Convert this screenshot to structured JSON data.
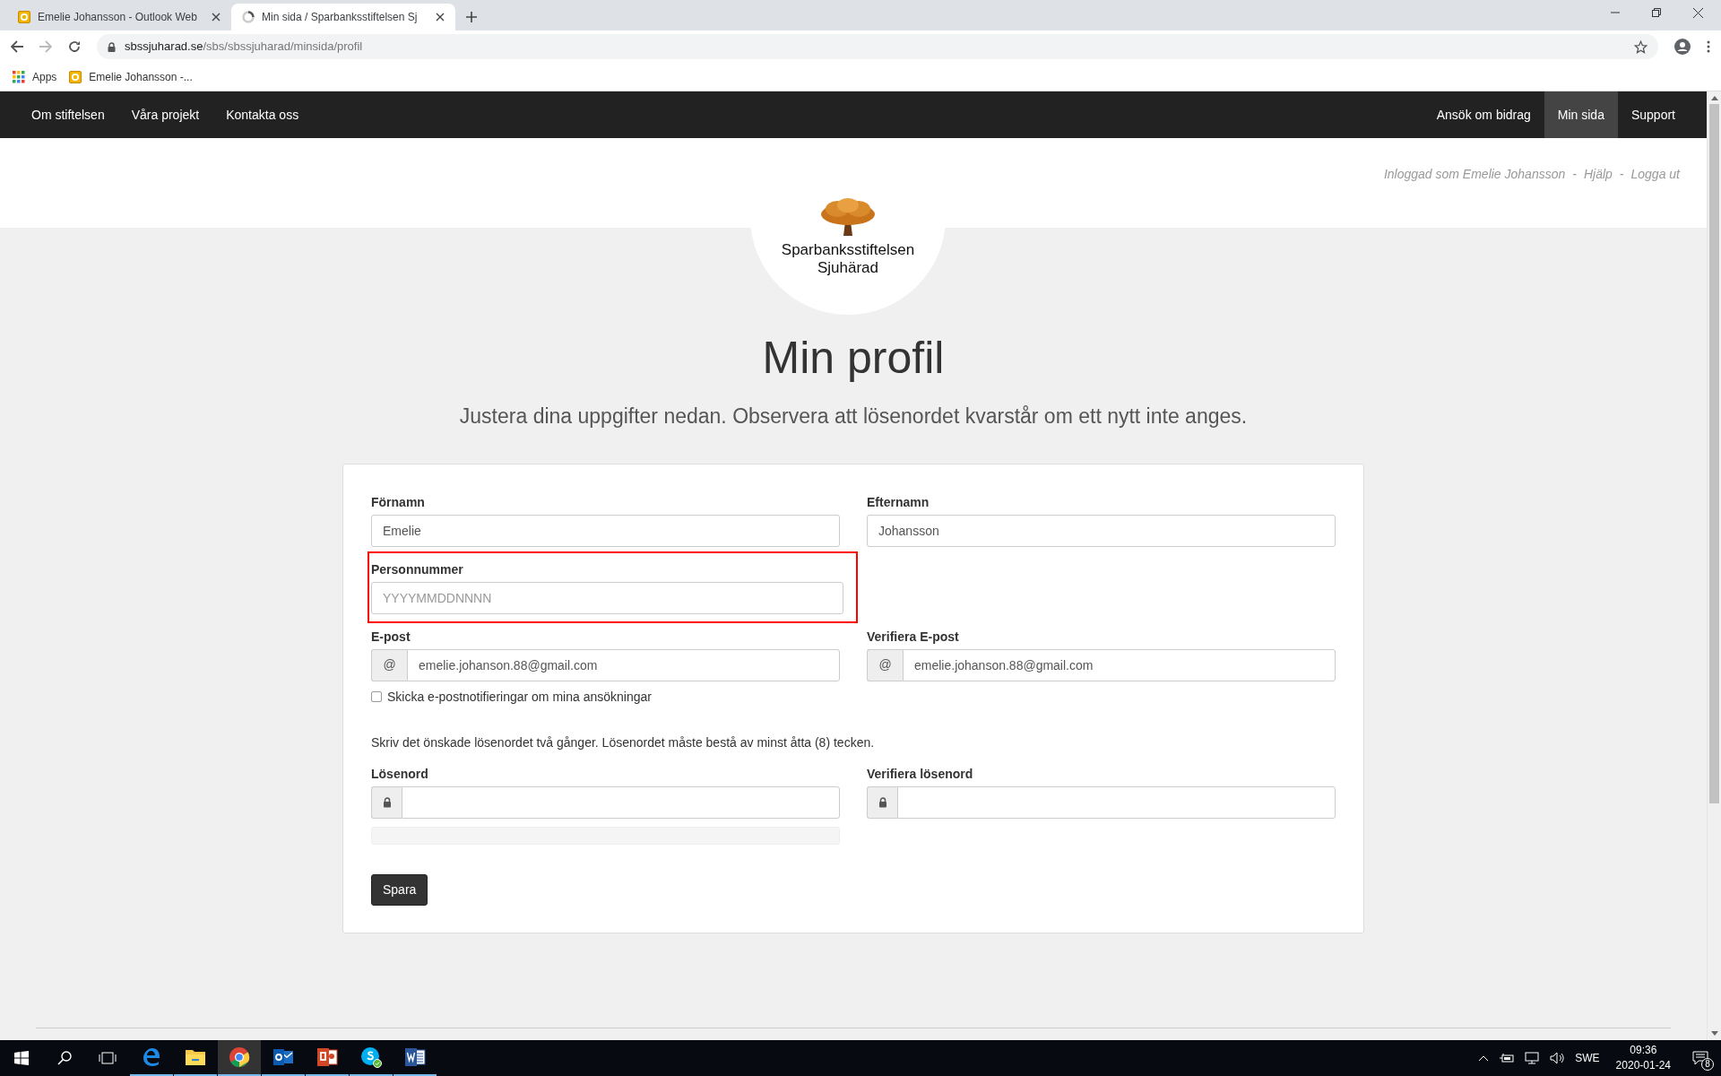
{
  "browser": {
    "tabs": [
      {
        "title": "Emelie Johansson - Outlook Web",
        "selected": false
      },
      {
        "title": "Min sida / Sparbanksstiftelsen Sj",
        "selected": true
      }
    ],
    "url": {
      "domain": "sbssjuharad.se",
      "path": "/sbs/sbssjuharad/minsida/profil"
    },
    "bookmarks": [
      {
        "label": "Apps"
      },
      {
        "label": "Emelie Johansson -..."
      }
    ]
  },
  "nav": {
    "left": [
      {
        "label": "Om stiftelsen",
        "selected": false
      },
      {
        "label": "Våra projekt",
        "selected": false
      },
      {
        "label": "Kontakta oss",
        "selected": false
      }
    ],
    "right": [
      {
        "label": "Ansök om bidrag",
        "selected": false
      },
      {
        "label": "Min sida",
        "selected": true
      },
      {
        "label": "Support",
        "selected": false
      }
    ]
  },
  "header": {
    "logo_lines": [
      "Sparbanksstiftelsen",
      "Sjuhärad"
    ],
    "user_links": [
      "Inloggad som Emelie Johansson",
      "-",
      "Hjälp",
      "-",
      "Logga ut"
    ]
  },
  "page": {
    "title": "Min profil",
    "subtitle": "Justera dina uppgifter nedan. Observera att lösenordet kvarstår om ett nytt inte anges."
  },
  "form": {
    "rows": [
      {
        "kind": "fields",
        "fields": [
          {
            "kind": "plain",
            "label": "Förnamn",
            "value": "Emelie",
            "highlighted": false
          },
          {
            "kind": "plain",
            "label": "Efternamn",
            "value": "Johansson",
            "highlighted": false
          }
        ]
      },
      {
        "kind": "fields",
        "fields": [
          {
            "kind": "plain",
            "label": "Personnummer",
            "placeholder": "YYYYMMDDNNNN",
            "highlighted": true
          }
        ]
      },
      {
        "kind": "fields",
        "fields": [
          {
            "kind": "email",
            "label": "E-post",
            "value": "emelie.johanson.88@gmail.com",
            "addon_text": "@",
            "highlighted": false
          },
          {
            "kind": "email",
            "label": "Verifiera E-post",
            "value": "emelie.johanson.88@gmail.com",
            "addon_text": "@",
            "highlighted": false
          }
        ]
      },
      {
        "kind": "checkbox",
        "label": "Skicka e-postnotifieringar om mina ansökningar",
        "checked": false
      },
      {
        "kind": "note",
        "text": "Skriv det önskade lösenordet två gånger. Lösenordet måste bestå av minst åtta (8) tecken."
      },
      {
        "kind": "fields",
        "fields": [
          {
            "kind": "password",
            "label": "Lösenord",
            "highlighted": false,
            "strength_meter": {
              "level": 0
            }
          },
          {
            "kind": "password",
            "label": "Verifiera lösenord",
            "highlighted": false
          }
        ]
      },
      {
        "kind": "button",
        "label": "Spara"
      }
    ]
  },
  "taskbar": {
    "apps": [
      {
        "kind": "edge",
        "selected": false,
        "running": true
      },
      {
        "kind": "explorer",
        "selected": false,
        "running": true
      },
      {
        "kind": "chrome",
        "selected": true,
        "running": true
      },
      {
        "kind": "outlook",
        "selected": false,
        "running": true
      },
      {
        "kind": "powerpoint",
        "selected": false,
        "running": true
      },
      {
        "kind": "skype",
        "selected": false,
        "running": true
      },
      {
        "kind": "word",
        "selected": false,
        "running": true
      }
    ],
    "language": "SWE",
    "time": "09:36",
    "date": "2020-01-24",
    "notifications": "8"
  }
}
